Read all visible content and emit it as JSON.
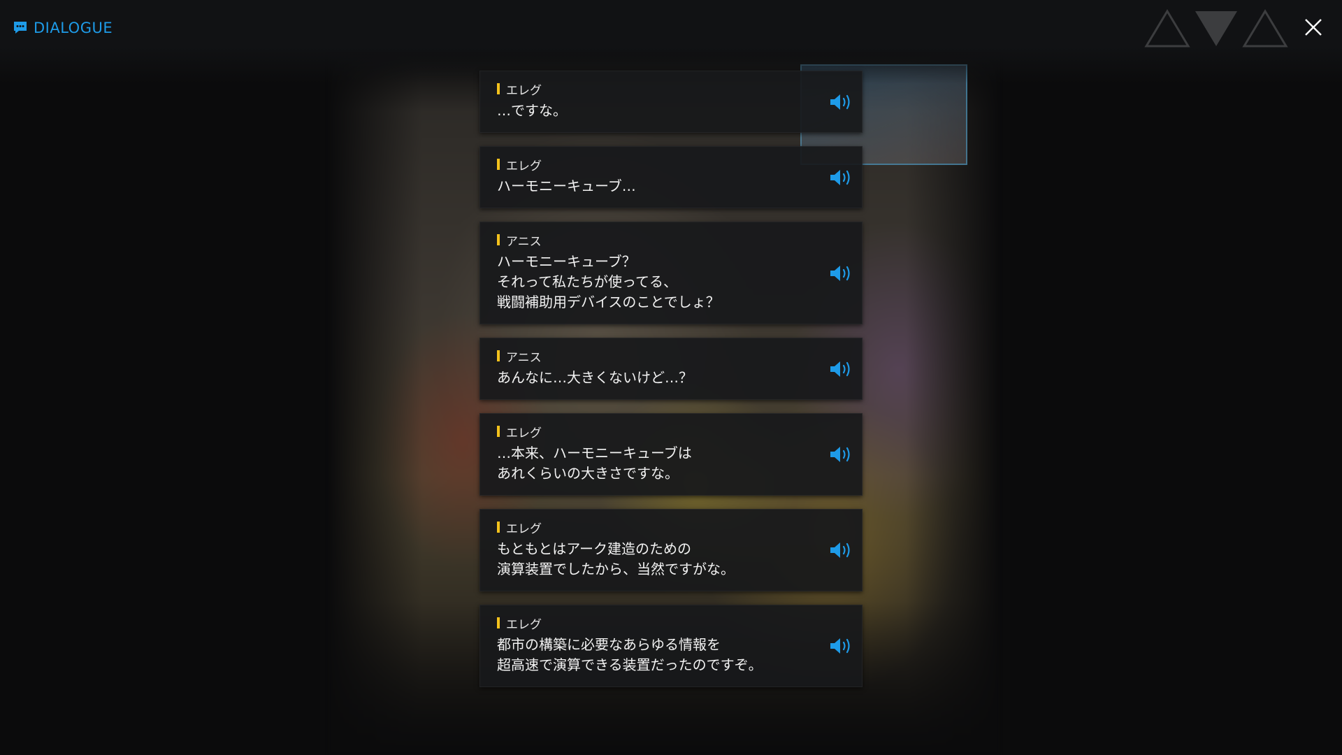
{
  "header": {
    "title": "DIALOGUE",
    "chat_icon": "chat-bubble-icon",
    "close_icon": "close-icon"
  },
  "colors": {
    "accent": "#1e9be8",
    "speaker_marker": "#f4c21c"
  },
  "dialogue": [
    {
      "speaker": "エレグ",
      "text": "…ですな。",
      "voice_icon": "speaker-icon"
    },
    {
      "speaker": "エレグ",
      "text": "ハーモニーキューブ…",
      "voice_icon": "speaker-icon"
    },
    {
      "speaker": "アニス",
      "text": "ハーモニーキューブ？\nそれって私たちが使ってる、\n戦闘補助用デバイスのことでしょ？",
      "voice_icon": "speaker-icon"
    },
    {
      "speaker": "アニス",
      "text": "あんなに…大きくないけど…？",
      "voice_icon": "speaker-icon"
    },
    {
      "speaker": "エレグ",
      "text": "…本来、ハーモニーキューブは\nあれくらいの大きさですな。",
      "voice_icon": "speaker-icon"
    },
    {
      "speaker": "エレグ",
      "text": "もともとはアーク建造のための\n演算装置でしたから、当然ですがな。",
      "voice_icon": "speaker-icon"
    },
    {
      "speaker": "エレグ",
      "text": "都市の構築に必要なあらゆる情報を\n超高速で演算できる装置だったのですぞ。",
      "voice_icon": "speaker-icon"
    }
  ]
}
